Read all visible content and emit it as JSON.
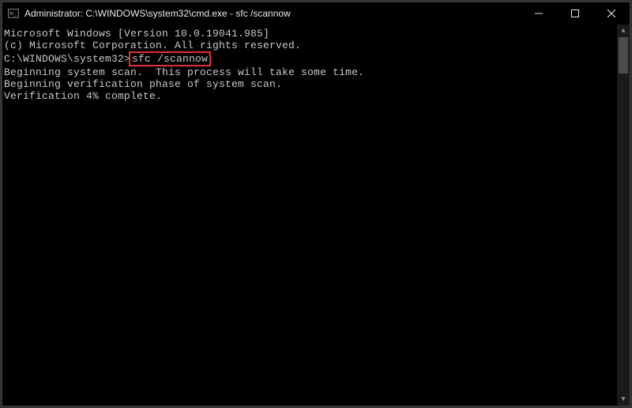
{
  "titlebar": {
    "icon_name": "cmd-icon",
    "title": "Administrator: C:\\WINDOWS\\system32\\cmd.exe - sfc  /scannow"
  },
  "terminal": {
    "line1": "Microsoft Windows [Version 10.0.19041.985]",
    "line2": "(c) Microsoft Corporation. All rights reserved.",
    "blank1": "",
    "prompt": "C:\\WINDOWS\\system32>",
    "command": "sfc /scannow",
    "blank2": "",
    "line3": "Beginning system scan.  This process will take some time.",
    "blank3": "",
    "line4": "Beginning verification phase of system scan.",
    "line5": "Verification 4% complete."
  }
}
